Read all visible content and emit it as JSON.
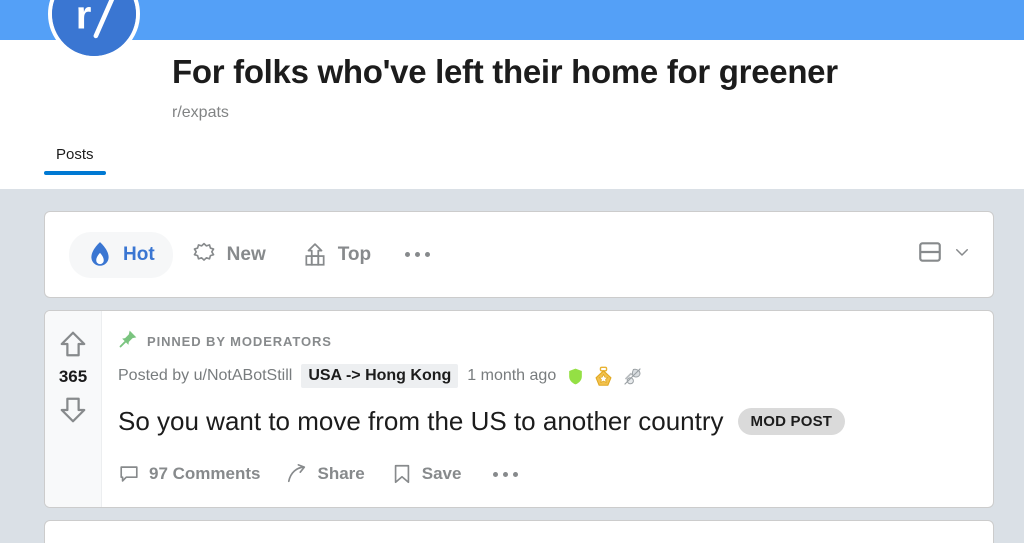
{
  "community": {
    "title": "For folks who've left their home for greener",
    "name": "r/expats",
    "avatar_text": "r/",
    "banner_color": "#54a0f7",
    "avatar_color": "#3a76d2",
    "tabs": [
      {
        "label": "Posts",
        "active": true
      }
    ]
  },
  "sortbar": {
    "options": [
      {
        "label": "Hot",
        "icon": "flame-icon",
        "active": true
      },
      {
        "label": "New",
        "icon": "starburst-icon",
        "active": false
      },
      {
        "label": "Top",
        "icon": "chart-up-icon",
        "active": false
      }
    ],
    "more_label": "...",
    "view_mode": "card-view-icon",
    "accent_color": "#3a76d2"
  },
  "post": {
    "score": "365",
    "upvote": "upvote-arrow",
    "downvote": "downvote-arrow",
    "pinned_label": "PINNED BY MODERATORS",
    "pin_color": "#7ac47f",
    "posted_by": "Posted by u/NotABotStill",
    "flair": "USA -> Hong Kong",
    "timestamp": "1 month ago",
    "awards": [
      {
        "name": "shield-award-icon",
        "color": "#94e044"
      },
      {
        "name": "gold-star-award-icon",
        "color": "#f2c14e"
      },
      {
        "name": "silver-helping-hand-award-icon",
        "color": "#c8c8c8"
      }
    ],
    "title": "So you want to move from the US to another country",
    "mod_badge": "MOD POST",
    "actions": [
      {
        "label": "97 Comments",
        "icon": "comment-bubble-icon"
      },
      {
        "label": "Share",
        "icon": "share-arrow-icon"
      },
      {
        "label": "Save",
        "icon": "bookmark-icon"
      }
    ],
    "more_label": "..."
  }
}
